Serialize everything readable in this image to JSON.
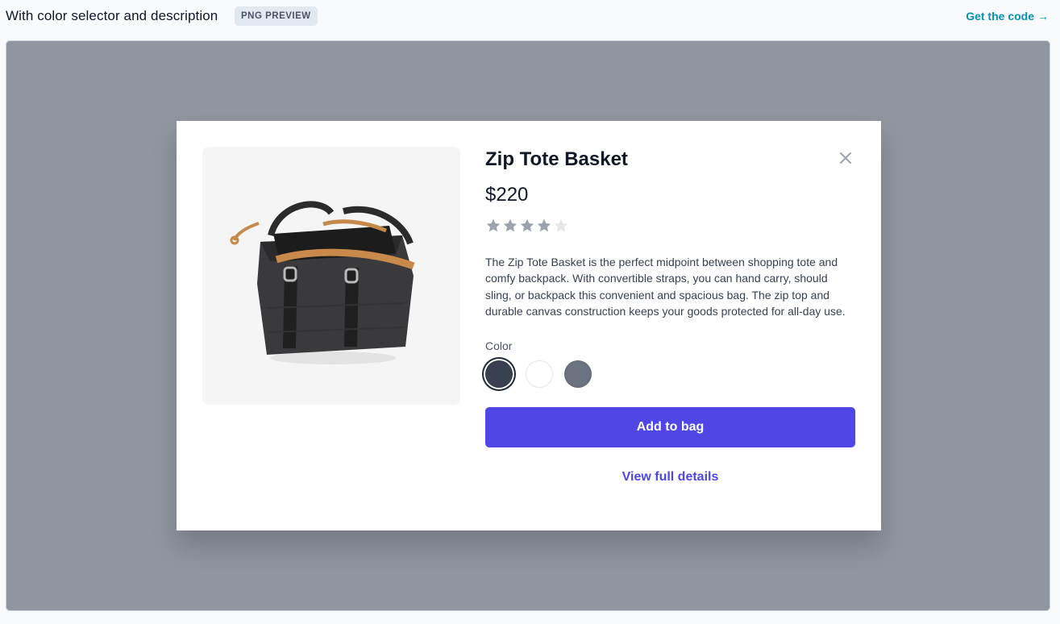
{
  "header": {
    "title": "With color selector and description",
    "badge": "PNG PREVIEW",
    "code_link": "Get the code",
    "code_link_arrow": "→"
  },
  "product": {
    "name": "Zip Tote Basket",
    "price": "$220",
    "rating": 4,
    "rating_max": 5,
    "description": "The Zip Tote Basket is the perfect midpoint between shopping tote and comfy backpack. With convertible straps, you can hand carry, should sling, or backpack this convenient and spacious bag. The zip top and durable canvas construction keeps your goods protected for all-day use.",
    "color_label": "Color",
    "colors": [
      {
        "hex": "#374151",
        "selected": true
      },
      {
        "hex": "#ffffff",
        "selected": false
      },
      {
        "hex": "#6b7280",
        "selected": false
      }
    ],
    "add_button": "Add to bag",
    "details_link": "View full details"
  },
  "icons": {
    "close": "close-icon",
    "star": "star-icon",
    "arrow": "arrow-right-icon"
  },
  "colors": {
    "accent": "#4f46e5",
    "link": "#0891b2",
    "star_filled": "#9ca3af",
    "star_empty": "#e5e7eb",
    "backdrop": "#9095a0"
  }
}
